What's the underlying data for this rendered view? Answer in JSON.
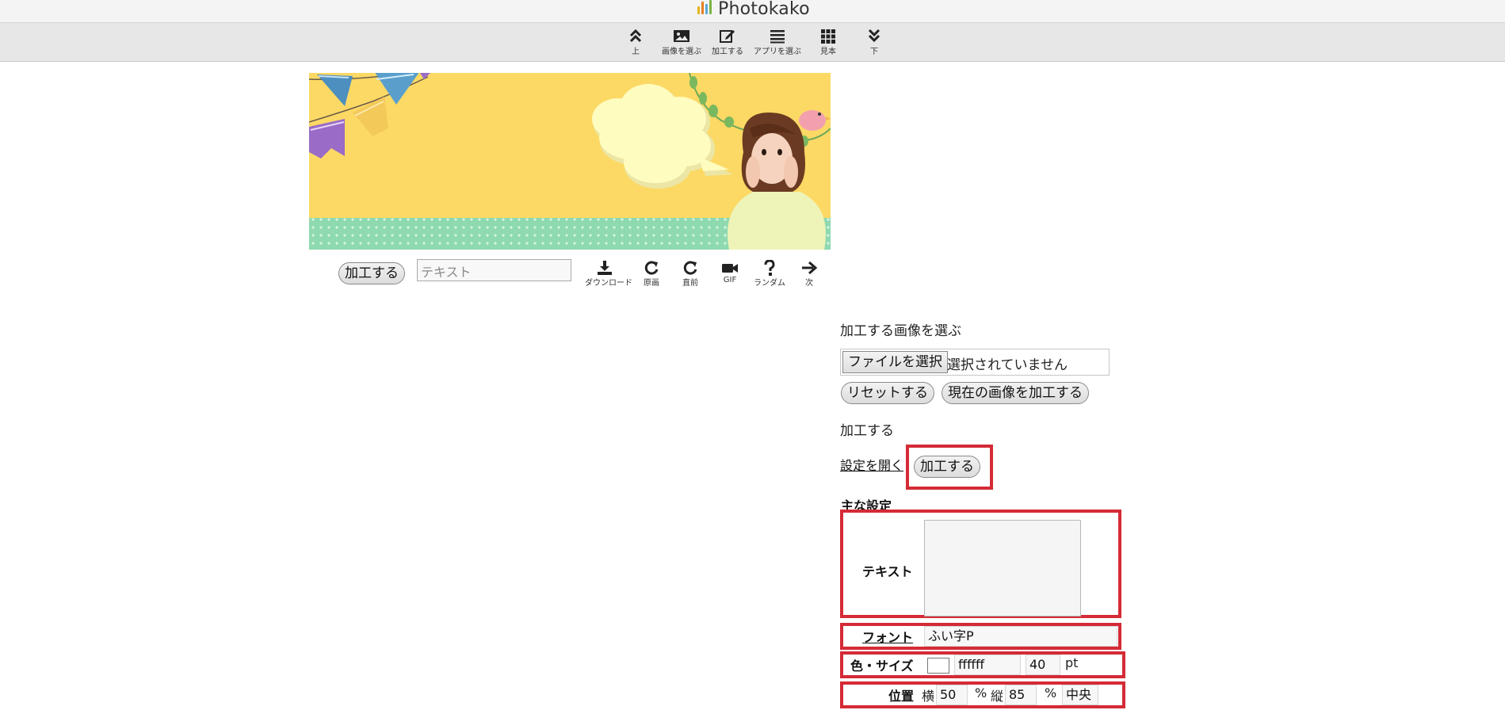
{
  "app": {
    "name": "Photokako",
    "logo_colors": [
      "#e6b422",
      "#e67e22",
      "#5aa7d9",
      "#7cb342"
    ]
  },
  "toolbar": {
    "items": [
      {
        "label": "上",
        "icon": "double-chevron-up-icon"
      },
      {
        "label": "画像を選ぶ",
        "icon": "image-icon"
      },
      {
        "label": "加工する",
        "icon": "edit-icon"
      },
      {
        "label": "アプリを選ぶ",
        "icon": "list-icon"
      },
      {
        "label": "見本",
        "icon": "grid-icon"
      },
      {
        "label": "下",
        "icon": "double-chevron-down-icon"
      }
    ]
  },
  "image_actions": {
    "process_label": "加工する",
    "text_placeholder": "テキスト",
    "buttons": [
      {
        "label": "ダウンロード",
        "icon": "download-icon"
      },
      {
        "label": "原画",
        "icon": "refresh-icon"
      },
      {
        "label": "直前",
        "icon": "refresh-icon"
      },
      {
        "label": "GIF",
        "icon": "video-camera-icon"
      },
      {
        "label": "ランダム",
        "icon": "question-icon"
      },
      {
        "label": "次",
        "icon": "arrow-right-icon"
      }
    ]
  },
  "panel": {
    "choose_heading": "加工する画像を選ぶ",
    "file_button": "ファイルを選択",
    "file_status": "選択されていません",
    "reset_button": "リセットする",
    "process_current_button": "現在の画像を加工する",
    "process_heading": "加工する",
    "open_settings_link": "設定を開く",
    "process_button": "加工する",
    "main_settings": "主な設定",
    "text_label": "テキスト",
    "text_value": "",
    "font_label": "フォント",
    "font_value": "ふい字P",
    "color_size_label": "色・サイズ",
    "color_value": "ffffff",
    "swatch_color": "#ffffff",
    "size_value": "40",
    "size_unit": "pt",
    "position_label": "位置",
    "horizontal_label": "横",
    "horizontal_value": "50",
    "percent_unit_1": "%",
    "vertical_label": "縦",
    "vertical_value": "85",
    "percent_unit_2": "%",
    "align_value": "中央"
  },
  "colors": {
    "highlight": "#d42b36",
    "banner_yellow": "#fcd964",
    "banner_green": "#8ed9b0"
  }
}
